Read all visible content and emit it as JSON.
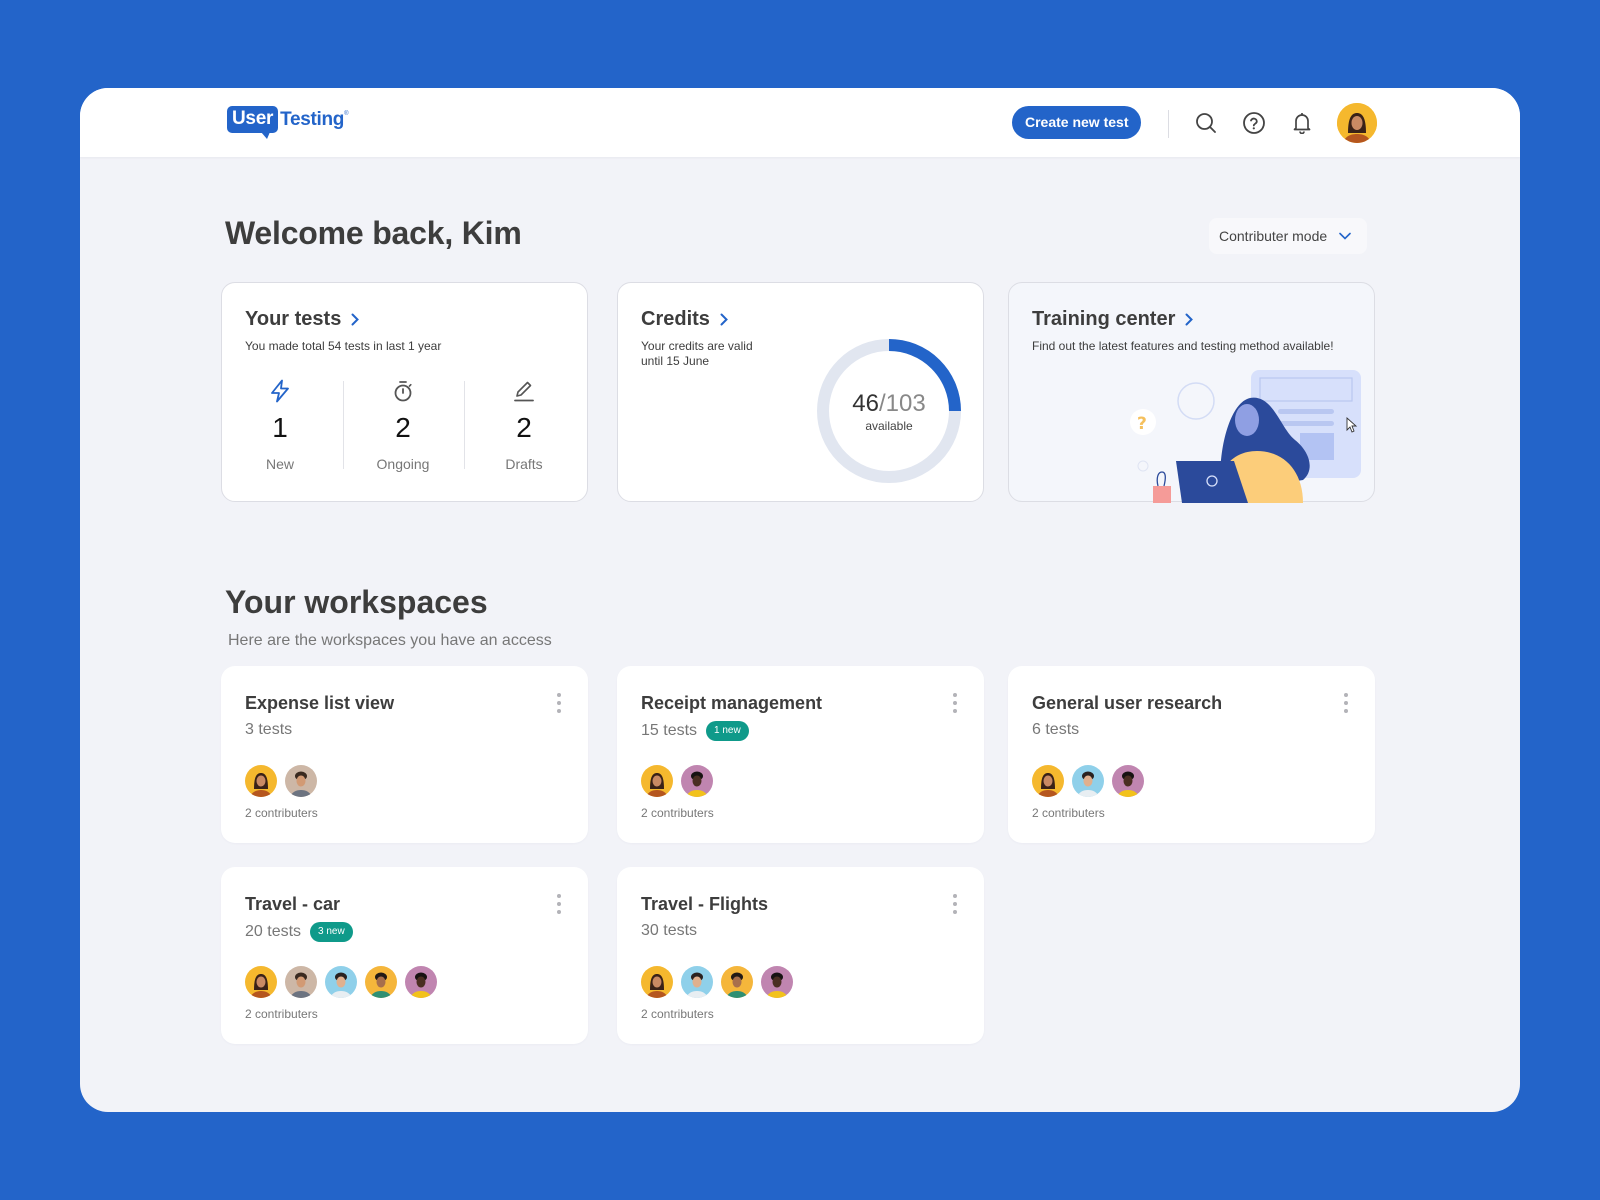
{
  "brand": {
    "logo_user": "User",
    "logo_testing": "Testing",
    "logo_reg": "®",
    "primary_color": "#2364c9",
    "badge_color": "#0f9a8a"
  },
  "header": {
    "create_button": "Create new test",
    "icons": [
      "search-icon",
      "help-icon",
      "bell-icon",
      "user-avatar"
    ]
  },
  "welcome": {
    "title": "Welcome back, Kim",
    "mode_select": "Contributer mode"
  },
  "summary": {
    "tests": {
      "title": "Your tests",
      "subtitle": "You made total 54 tests in last 1 year",
      "stats": [
        {
          "icon": "lightning-icon",
          "value": "1",
          "label": "New"
        },
        {
          "icon": "stopwatch-icon",
          "value": "2",
          "label": "Ongoing"
        },
        {
          "icon": "pencil-icon",
          "value": "2",
          "label": "Drafts"
        }
      ]
    },
    "credits": {
      "title": "Credits",
      "subtitle_line1": "Your credits are valid",
      "subtitle_line2": "until 15 June",
      "available": "46",
      "total": "/103",
      "available_label": "available",
      "ring_fill_fraction": 0.25
    },
    "training": {
      "title": "Training center",
      "subtitle": "Find out the latest features and testing method available!"
    }
  },
  "workspaces": {
    "title": "Your workspaces",
    "subtitle": "Here are the workspaces you have an access",
    "items": [
      {
        "name": "Expense list view",
        "count": "3 tests",
        "badge": "",
        "avatars": [
          "woman-yellow",
          "man-beige"
        ],
        "contributors": "2 contributers"
      },
      {
        "name": "Receipt management",
        "count": "15 tests",
        "badge": "1 new",
        "avatars": [
          "woman-yellow",
          "woman-purple"
        ],
        "contributors": "2 contributers"
      },
      {
        "name": "General user research",
        "count": "6 tests",
        "badge": "",
        "avatars": [
          "woman-yellow",
          "man-blue",
          "woman-purple"
        ],
        "contributors": "2 contributers"
      },
      {
        "name": "Travel - car",
        "count": "20 tests",
        "badge": "3 new",
        "avatars": [
          "woman-yellow",
          "man-beige",
          "man-blue",
          "man-orange",
          "woman-purple"
        ],
        "contributors": "2 contributers"
      },
      {
        "name": "Travel - Flights",
        "count": "30 tests",
        "badge": "",
        "avatars": [
          "woman-yellow",
          "man-blue",
          "man-orange",
          "woman-purple"
        ],
        "contributors": "2 contributers"
      }
    ]
  }
}
